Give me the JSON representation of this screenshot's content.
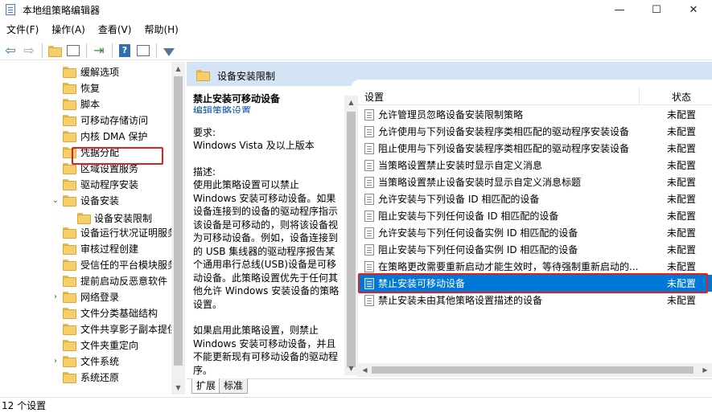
{
  "window": {
    "title": "本地组策略编辑器",
    "minimize": "—",
    "maximize": "☐",
    "close": "✕"
  },
  "menu": [
    "文件(F)",
    "操作(A)",
    "查看(V)",
    "帮助(H)"
  ],
  "toolbar": {
    "icons": [
      "back-arrow-icon",
      "forward-arrow-icon",
      "folder-up-icon",
      "show-hide-tree-icon",
      "export-list-icon",
      "help-icon",
      "properties-icon",
      "filter-icon"
    ]
  },
  "tree": {
    "items": [
      {
        "label": "缓解选项",
        "expander": ""
      },
      {
        "label": "恢复",
        "expander": ""
      },
      {
        "label": "脚本",
        "expander": ""
      },
      {
        "label": "可移动存储访问",
        "expander": ""
      },
      {
        "label": "内核 DMA 保护",
        "expander": ""
      },
      {
        "label": "凭据分配",
        "expander": ""
      },
      {
        "label": "区域设置服务",
        "expander": ""
      },
      {
        "label": "驱动程序安装",
        "expander": ""
      },
      {
        "label": "设备安装",
        "expander": "⌄"
      },
      {
        "label": "设备安装限制",
        "expander": ""
      },
      {
        "label": "设备运行状况证明服务",
        "expander": ""
      },
      {
        "label": "审核过程创建",
        "expander": ""
      },
      {
        "label": "受信任的平台模块服务",
        "expander": ""
      },
      {
        "label": "提前启动反恶意软件",
        "expander": ""
      },
      {
        "label": "网络登录",
        "expander": "›"
      },
      {
        "label": "文件分类基础结构",
        "expander": ""
      },
      {
        "label": "文件共享影子副本提供程序",
        "expander": ""
      },
      {
        "label": "文件夹重定向",
        "expander": ""
      },
      {
        "label": "文件系统",
        "expander": "›"
      },
      {
        "label": "系统还原",
        "expander": ""
      }
    ]
  },
  "right_pane": {
    "header_title": "设备安装限制",
    "description": {
      "title": "禁止安装可移动设备",
      "edit_link": "编辑策略设置",
      "requirements_label": "要求:",
      "requirements_value": "Windows Vista 及以上版本",
      "desc_label": "描述:",
      "desc_text": "使用此策略设置可以禁止 Windows 安装可移动设备。如果设备连接到的设备的驱动程序指示该设备是可移动的，则将该设备视为可移动设备。例如，设备连接到的 USB 集线器的驱动程序报告某个通用串行总线(USB)设备是可移动设备。此策略设置优先于任何其他允许 Windows 安装设备的策略设置。",
      "desc_text2": "如果启用此策略设置，则禁止 Windows 安装可移动设备，并且不能更新现有可移动设备的驱动程序。"
    },
    "list": {
      "col_setting": "设置",
      "col_state": "状态",
      "rows": [
        {
          "name": "允许管理员忽略设备安装限制策略",
          "state": "未配置"
        },
        {
          "name": "允许使用与下列设备安装程序类相匹配的驱动程序安装设备",
          "state": "未配置"
        },
        {
          "name": "阻止使用与下列设备安装程序类相匹配的驱动程序安装设备",
          "state": "未配置"
        },
        {
          "name": "当策略设置禁止安装时显示自定义消息",
          "state": "未配置"
        },
        {
          "name": "当策略设置禁止设备安装时显示自定义消息标题",
          "state": "未配置"
        },
        {
          "name": "允许安装与下列设备 ID 相匹配的设备",
          "state": "未配置"
        },
        {
          "name": "阻止安装与下列任何设备 ID 相匹配的设备",
          "state": "未配置"
        },
        {
          "name": "允许安装与下列任何设备实例 ID 相匹配的设备",
          "state": "未配置"
        },
        {
          "name": "阻止安装与下列任何设备实例 ID 相匹配的设备",
          "state": "未配置"
        },
        {
          "name": "在策略更改需要重新启动才能生效时，等待强制重新启动的...",
          "state": "未配置"
        },
        {
          "name": "禁止安装可移动设备",
          "state": "未配置"
        },
        {
          "name": "禁止安装未由其他策略设置描述的设备",
          "state": "未配置"
        }
      ]
    },
    "tabs": [
      "扩展",
      "标准"
    ]
  },
  "statusbar": {
    "text": "12 个设置"
  }
}
